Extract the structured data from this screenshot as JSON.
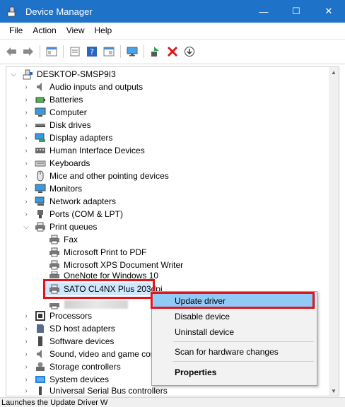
{
  "window": {
    "title": "Device Manager",
    "minimize_glyph": "—",
    "maximize_glyph": "☐",
    "close_glyph": "✕",
    "accent": "#1e73c8"
  },
  "menu": {
    "file": "File",
    "action": "Action",
    "view": "View",
    "help": "Help"
  },
  "toolbar": {
    "icons": [
      "back-arrow-icon",
      "forward-arrow-icon",
      "show-hide-console-tree-icon",
      "properties-icon",
      "help-icon",
      "details-view-icon",
      "monitor-icon",
      "update-driver-icon",
      "uninstall-icon",
      "download-icon"
    ]
  },
  "tree": {
    "root": "DESKTOP-SMSP9I3",
    "categories": [
      "Audio inputs and outputs",
      "Batteries",
      "Computer",
      "Disk drives",
      "Display adapters",
      "Human Interface Devices",
      "Keyboards",
      "Mice and other pointing devices",
      "Monitors",
      "Network adapters",
      "Ports (COM & LPT)",
      "Print queues"
    ],
    "print_queue_items": [
      "Fax",
      "Microsoft Print to PDF",
      "Microsoft XPS Document Writer",
      "OneNote for Windows 10",
      "SATO CL4NX Plus 203dpi"
    ],
    "categories_after": [
      "Processors",
      "SD host adapters",
      "Software devices",
      "Sound, video and game controllers",
      "Storage controllers",
      "System devices",
      "Universal Serial Bus controllers"
    ]
  },
  "context_menu": {
    "update_driver": "Update driver",
    "disable_device": "Disable device",
    "uninstall_device": "Uninstall device",
    "scan_hardware": "Scan for hardware changes",
    "properties": "Properties"
  },
  "status": {
    "text": "Launches the Update Driver W"
  },
  "colors": {
    "highlight_red": "#e0161d",
    "menu_highlight": "#91c9f7"
  }
}
